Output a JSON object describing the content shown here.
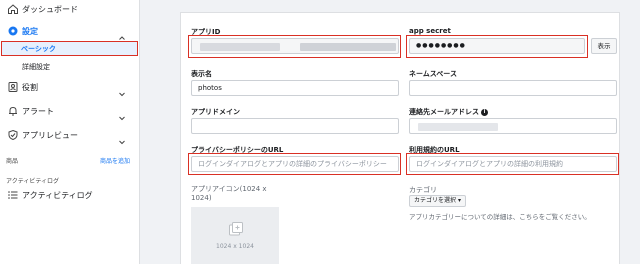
{
  "sidebar": {
    "dashboard_label": "ダッシュボード",
    "settings_label": "設定",
    "basic_label": "ベーシック",
    "advanced_label": "詳細設定",
    "roles_label": "役割",
    "alerts_label": "アラート",
    "app_review_label": "アプリレビュー",
    "products_label": "商品",
    "add_product_label": "商品を追加",
    "activity_section_label": "アクティビティログ",
    "activity_log_label": "アクティビティログ"
  },
  "form": {
    "app_id_label": "アプリID",
    "app_id_value": "",
    "app_secret_label": "app secret",
    "app_secret_value": "●●●●●●●●",
    "show_button": "表示",
    "display_name_label": "表示名",
    "display_name_value": "photos",
    "namespace_label": "ネームスペース",
    "namespace_value": "",
    "app_domain_label": "アプリドメイン",
    "app_domain_value": "",
    "contact_email_label": "連絡先メールアドレス",
    "privacy_url_label": "プライバシーポリシーのURL",
    "privacy_url_placeholder": "ログインダイアログとアプリの詳細のプライバシーポリシー",
    "terms_url_label": "利用規約のURL",
    "terms_url_placeholder": "ログインダイアログとアプリの詳細の利用規約",
    "app_icon_label": "アプリアイコン(1024 x 1024)",
    "icon_size_text": "1024 x 1024",
    "category_label": "カテゴリ",
    "category_select": "カテゴリを選択",
    "category_help": "アプリカテゴリーについての詳細は、こちらをご覧ください。"
  },
  "colors": {
    "highlight": "#d93025",
    "link": "#1877f2"
  }
}
